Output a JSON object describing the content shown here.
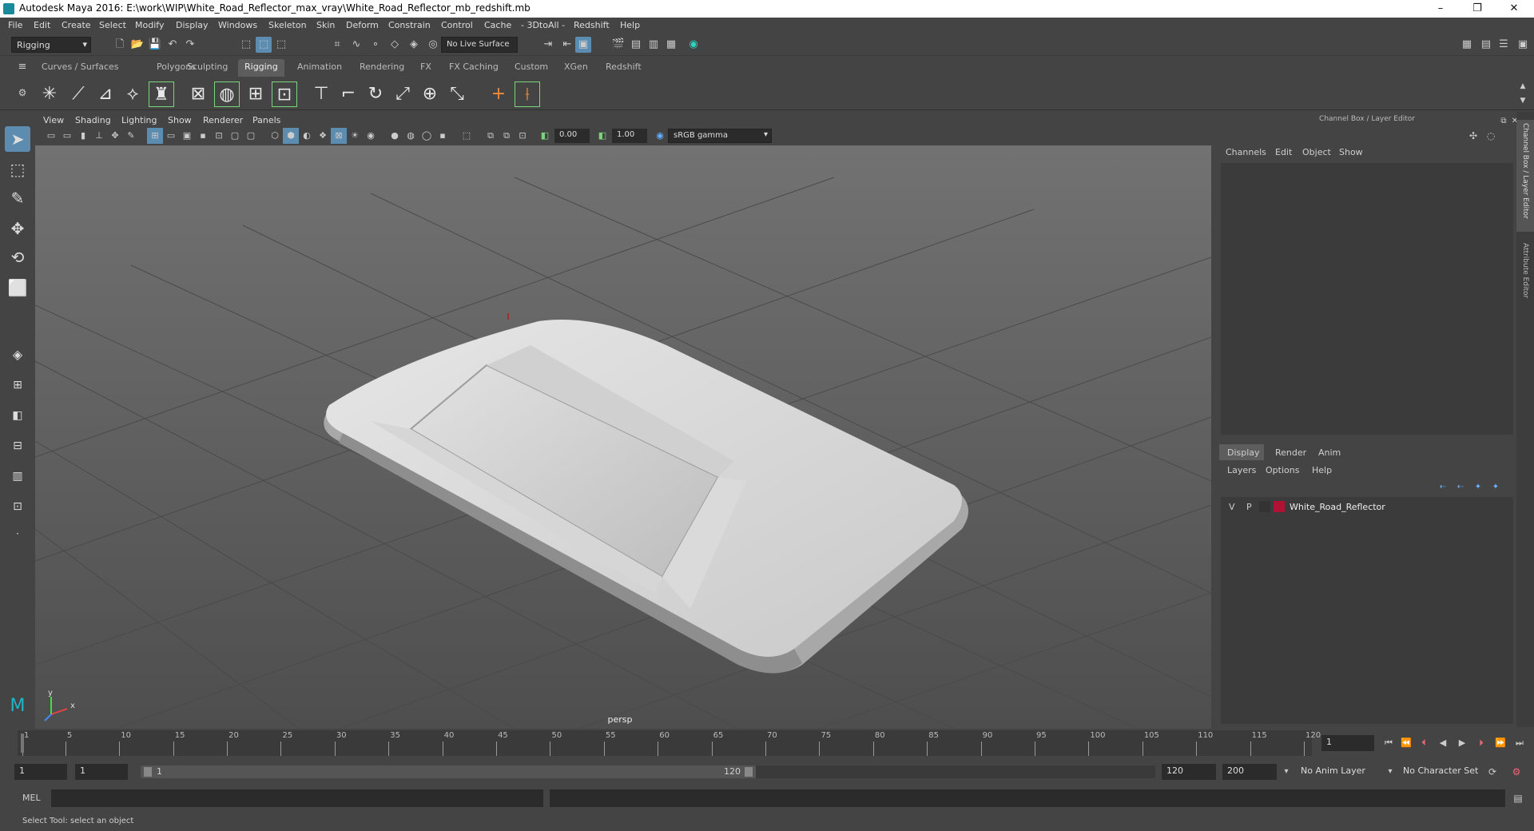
{
  "window": {
    "title": "Autodesk Maya 2016: E:\\work\\WIP\\White_Road_Reflector_max_vray\\White_Road_Reflector_mb_redshift.mb",
    "minimize": "–",
    "restore": "❐",
    "close": "✕"
  },
  "menubar": [
    "File",
    "Edit",
    "Create",
    "Select",
    "Modify",
    "Display",
    "Windows",
    "Skeleton",
    "Skin",
    "Deform",
    "Constrain",
    "Control",
    "Cache",
    "- 3DtoAll -",
    "Redshift",
    "Help"
  ],
  "statusline": {
    "mode": "Rigging",
    "live_surface": "No Live Surface"
  },
  "shelf_tabs": [
    "Curves / Surfaces",
    "Polygons",
    "Sculpting",
    "Rigging",
    "Animation",
    "Rendering",
    "FX",
    "FX Caching",
    "Custom",
    "XGen",
    "Redshift"
  ],
  "active_shelf": "Rigging",
  "viewport": {
    "menu": [
      "View",
      "Shading",
      "Lighting",
      "Show",
      "Renderer",
      "Panels"
    ],
    "exposure": "0.00",
    "gamma": "1.00",
    "color_space": "sRGB gamma",
    "camera_label": "persp",
    "axis_y": "y",
    "axis_x": "x"
  },
  "channel_box": {
    "title": "Channel Box / Layer Editor",
    "menu": [
      "Channels",
      "Edit",
      "Object",
      "Show"
    ]
  },
  "layer_editor": {
    "tabs": [
      "Display",
      "Render",
      "Anim"
    ],
    "active_tab": "Display",
    "menu": [
      "Layers",
      "Options",
      "Help"
    ],
    "layers": [
      {
        "visible": "V",
        "playback": "P",
        "name": "White_Road_Reflector",
        "color": "#b01235"
      }
    ]
  },
  "side_tabs": [
    "Channel Box / Layer Editor",
    "Attribute Editor"
  ],
  "time_slider": {
    "ticks": [
      "1",
      "5",
      "10",
      "15",
      "20",
      "25",
      "30",
      "35",
      "40",
      "45",
      "50",
      "55",
      "60",
      "65",
      "70",
      "75",
      "80",
      "85",
      "90",
      "95",
      "100",
      "105",
      "110",
      "115",
      "120"
    ],
    "current_frame": "1"
  },
  "range_slider": {
    "start": "1",
    "playback_start": "1",
    "range_start_label": "1",
    "range_end_label": "120",
    "playback_end": "120",
    "end": "200",
    "anim_layer": "No Anim Layer",
    "character_set": "No Character Set"
  },
  "command_line": {
    "label": "MEL"
  },
  "help_line": {
    "text": "Select Tool: select an object"
  }
}
